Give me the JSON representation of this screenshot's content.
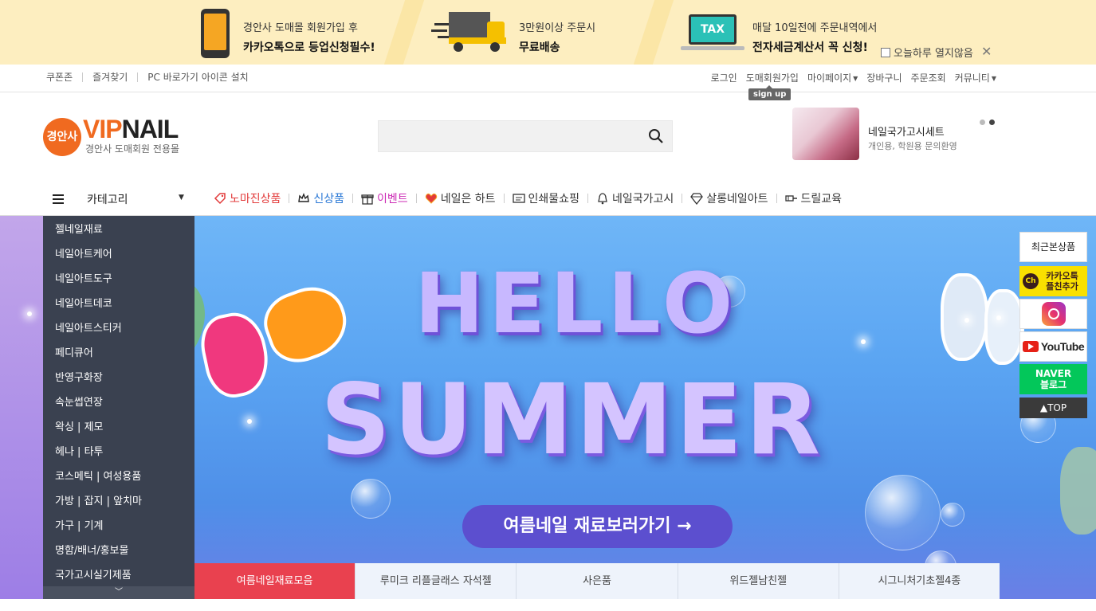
{
  "promo": {
    "item1": {
      "line1": "경안사 도매몰 회원가입 후",
      "line2": "카카오톡으로 등업신청필수!"
    },
    "item2": {
      "line1": "3만원이상 주문시",
      "line2": "무료배송"
    },
    "item3": {
      "badge": "TAX",
      "line1": "매달 10일전에 주문내역에서",
      "line2": "전자세금계산서 꼭 신청!"
    },
    "dismiss_label": "오늘하루 열지않음",
    "close_icon": "close-icon"
  },
  "util": {
    "left": [
      "쿠폰존",
      "즐겨찾기",
      "PC 바로가기 아이콘 설치"
    ],
    "login": "로그인",
    "signup": "도매회원가입",
    "mypage": "마이페이지",
    "cart": "장바구니",
    "orders": "주문조회",
    "community": "커뮤니티",
    "tooltip": "sign up"
  },
  "header": {
    "logo_badge": "경안사",
    "logo_vip": "VIP",
    "logo_nail": "NAIL",
    "logo_sub": "경안사 도매회원 전용몰",
    "search_placeholder": "",
    "promo_title": "네일국가고시세트",
    "promo_sub": "개인용, 학원용 문의환영"
  },
  "nav": {
    "category_label": "카테고리",
    "items": [
      {
        "label": "노마진상품",
        "color": "#e23a3a",
        "icon": "tag-icon"
      },
      {
        "label": "신상품",
        "color": "#2a78d6",
        "icon": "crown-icon"
      },
      {
        "label": "이벤트",
        "color": "#cc2bb5",
        "icon": "gift-icon"
      },
      {
        "label": "네일은 하트",
        "color": "#333333",
        "icon": "heart-icon"
      },
      {
        "label": "인쇄물쇼핑",
        "color": "#333333",
        "icon": "print-icon"
      },
      {
        "label": "네일국가고시",
        "color": "#333333",
        "icon": "bell-icon"
      },
      {
        "label": "살롱네일아트",
        "color": "#333333",
        "icon": "diamond-icon"
      },
      {
        "label": "드릴교육",
        "color": "#333333",
        "icon": "drill-icon"
      }
    ]
  },
  "sidecat": {
    "items": [
      "젤네일재료",
      "네일아트케어",
      "네일아트도구",
      "네일아트데코",
      "네일아트스티커",
      "페디큐어",
      "반영구화장",
      "속눈썹연장",
      "왁싱 | 제모",
      "헤나 | 타투",
      "코스메틱 | 여성용품",
      "가방 | 잡지 | 앞치마",
      "가구 | 기계",
      "명함/배너/홍보물",
      "국가고시실기제품"
    ]
  },
  "banner": {
    "title1": "HELLO",
    "title2": "SUMMER",
    "cta": "여름네일 재료보러가기 →",
    "tabs": [
      "여름네일재료모음",
      "루미크 리플글래스 자석젤",
      "사은품",
      "위드젤남친젤",
      "시그니처기초젤4종"
    ]
  },
  "floatpanel": {
    "recent": "최근본상품",
    "kakao_ch": "Ch",
    "kakao_line1": "카카오톡",
    "kakao_line2": "플친추가",
    "youtube": "YouTube",
    "naver_line1": "NAVER",
    "naver_line2": "블로그",
    "top": "▲TOP"
  },
  "colors": {
    "accent": "#e9414f",
    "brand": "#f06a20",
    "promo_bg": "#fdeec0",
    "side_bg": "#3a4150"
  }
}
